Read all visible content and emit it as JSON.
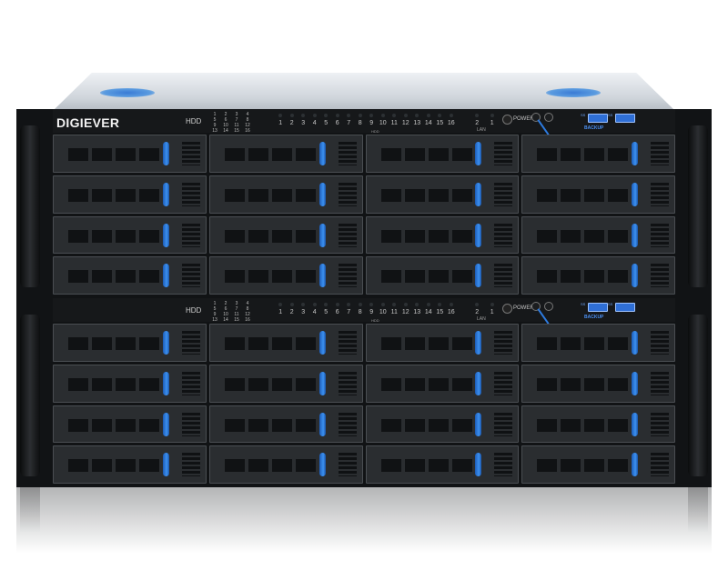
{
  "brand": "DIGIEVER",
  "front_panel": {
    "hdd_label": "HDD",
    "hdd_map": [
      "1",
      "2",
      "3",
      "4",
      "5",
      "6",
      "7",
      "8",
      "9",
      "10",
      "11",
      "12",
      "13",
      "14",
      "15",
      "16"
    ],
    "led_numbers": [
      "1",
      "2",
      "3",
      "4",
      "5",
      "6",
      "7",
      "8",
      "9",
      "10",
      "11",
      "12",
      "13",
      "14",
      "15",
      "16"
    ],
    "hdd_group_label": "HDD",
    "lan_numbers": [
      "2",
      "1"
    ],
    "lan_label": "LAN",
    "power_label": "POWER",
    "usb_tag": "SS",
    "backup_label": "BACKUP"
  },
  "colors": {
    "chassis": "#111315",
    "accent": "#2d7be0",
    "lid": "#cfd5db"
  },
  "units": 2,
  "bays_per_unit": 16
}
